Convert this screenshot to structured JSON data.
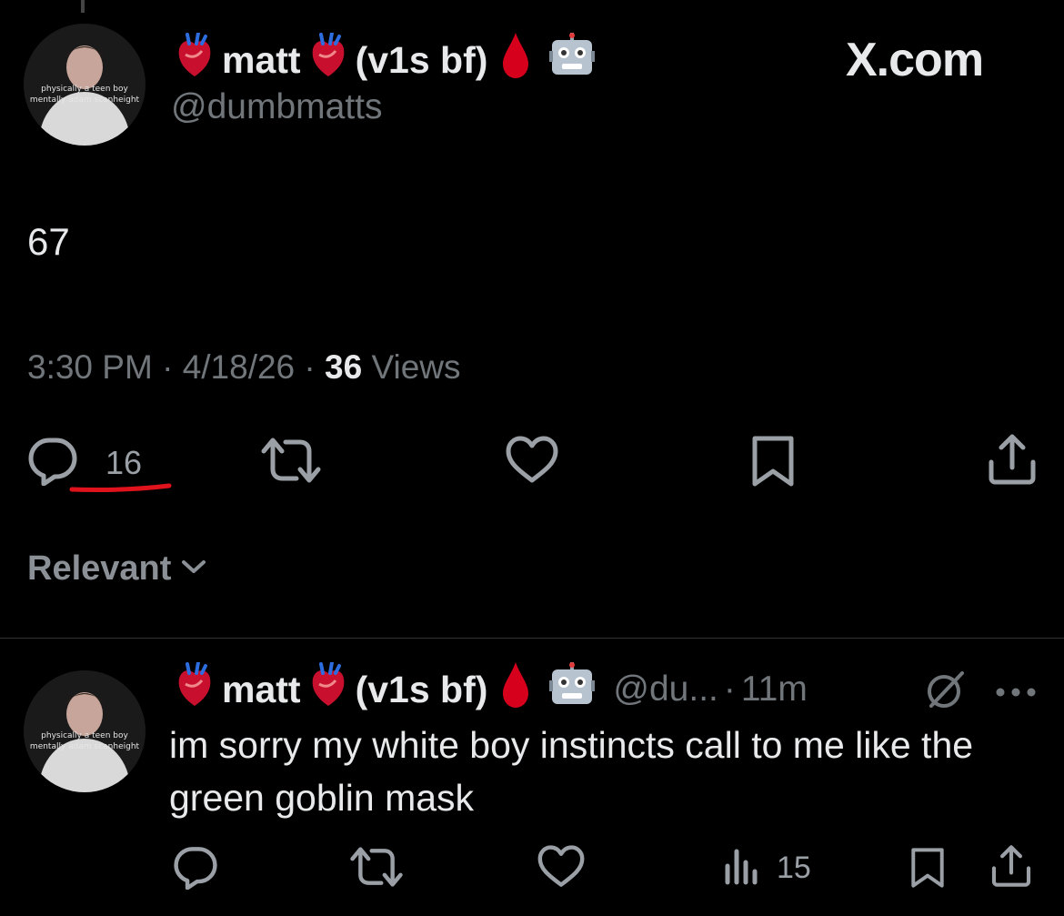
{
  "top_tweet": {
    "display_name_prefix": "matt",
    "display_name_suffix": "(v1s bf)",
    "handle": "@dumbmatts",
    "watermark": "X.com",
    "text": "67",
    "time": "3:30 PM",
    "date": "4/18/26",
    "views_count": "36",
    "views_label": "Views",
    "reply_count": "16",
    "avatar_caption_lines": [
      "physically a teen boy",
      "mentally adam scanheight"
    ],
    "icons": {
      "reply": "reply-icon",
      "retweet": "retweet-icon",
      "like": "heart-icon",
      "bookmark": "bookmark-icon",
      "share": "share-icon"
    },
    "annotation_color": "#e0121b"
  },
  "sort": {
    "label": "Relevant",
    "icon": "chevron-down-icon"
  },
  "reply_tweet": {
    "display_name_prefix": "matt",
    "display_name_suffix": "(v1s bf)",
    "handle_truncated": "@du...",
    "separator": "·",
    "age": "11m",
    "text": "im sorry my white boy instincts call to me like the green goblin mask",
    "views_count": "15",
    "icons": {
      "reply": "reply-icon",
      "retweet": "retweet-icon",
      "like": "heart-icon",
      "views": "analytics-icon",
      "bookmark": "bookmark-icon",
      "share": "share-icon",
      "more": "more-icon",
      "grok": "grok-icon"
    }
  },
  "colors": {
    "background": "#000000",
    "text": "#e7e9ea",
    "muted": "#71767b",
    "divider": "#2f3336",
    "blood_drop": "#d6001c",
    "heart_red": "#c8102e"
  }
}
